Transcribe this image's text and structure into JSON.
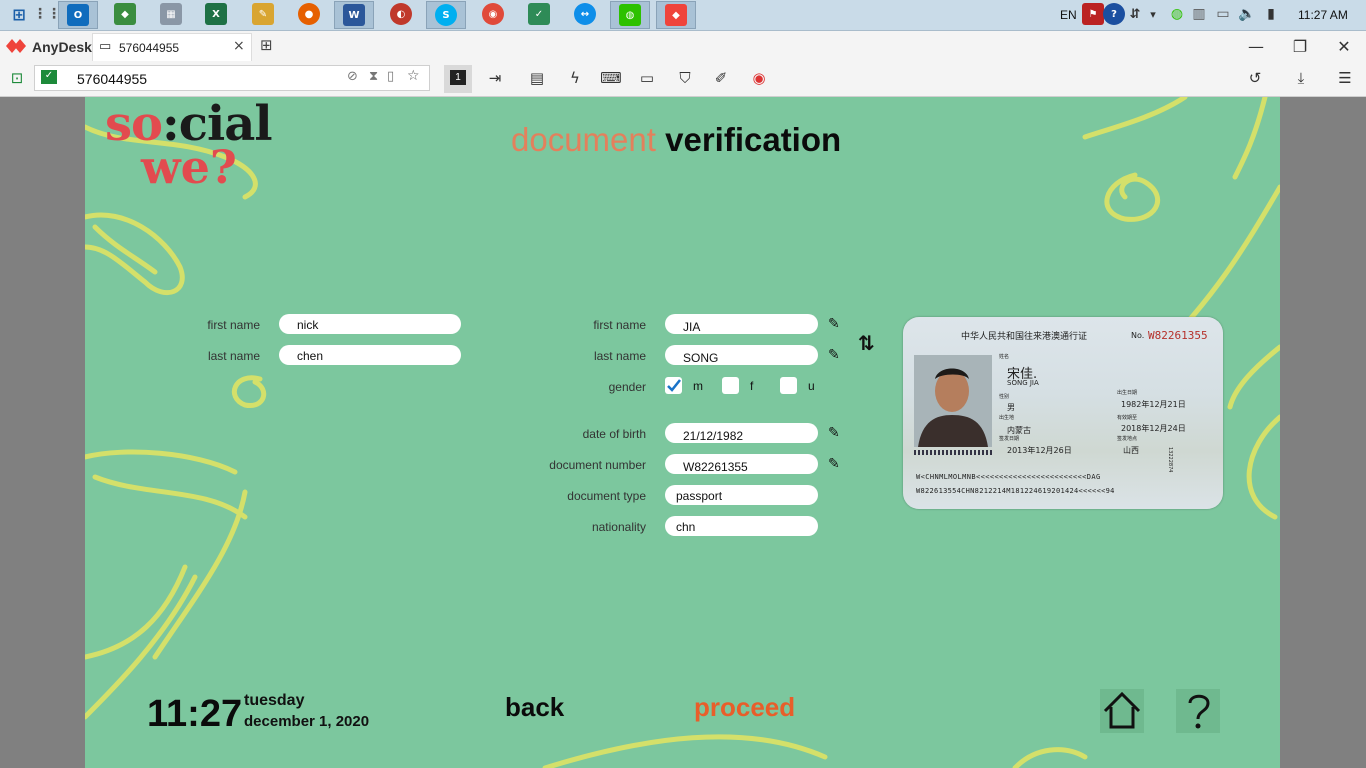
{
  "taskbar": {
    "clock": "11:27 AM",
    "language": "EN",
    "apps": [
      "outlook-icon",
      "app-icon",
      "calculator-icon",
      "excel-icon",
      "paint-icon",
      "firefox-icon",
      "word-icon",
      "anydesk-clone-icon",
      "skype-icon",
      "chrome-icon",
      "security-icon",
      "teamviewer-icon",
      "wechat-icon",
      "anydesk-icon"
    ]
  },
  "anydesk": {
    "app_name": "AnyDesk",
    "tab_label": "576044955",
    "address": "576044955",
    "display_number": "1"
  },
  "screen": {
    "logo_line1_a": "so",
    "logo_line1_b": ":cial",
    "logo_line2": "we?",
    "title_part1": "document",
    "title_part2": "verification",
    "left_form": {
      "first_name_label": "first name",
      "first_name_value": "nick",
      "last_name_label": "last name",
      "last_name_value": "chen"
    },
    "right_form": {
      "first_name_label": "first name",
      "first_name_value": "JIA",
      "last_name_label": "last name",
      "last_name_value": "SONG",
      "gender_label": "gender",
      "gender_options": [
        "m",
        "f",
        "u"
      ],
      "gender_selected": "m",
      "dob_label": "date of birth",
      "dob_value": "21/12/1982",
      "doc_number_label": "document number",
      "doc_number_value": "W82261355",
      "doc_type_label": "document type",
      "doc_type_value": "passport",
      "nationality_label": "nationality",
      "nationality_value": "chn"
    },
    "id_card": {
      "header": "中华人民共和国往来港澳通行证",
      "no_label": "No.",
      "no_value": "W82261355",
      "name_label": "姓名",
      "name_cn": "宋佳.",
      "name_en": "SONG JIA",
      "dob_label": "出生日期",
      "sex_label": "性别",
      "sex_value": "男",
      "dob_value": "1982年12月21日",
      "place_label": "出生地",
      "place_value": "内蒙古",
      "expiry_label": "有效期至",
      "expiry_value": "2018年12月24日",
      "issue_date_label": "签发日期",
      "issue_date_value": "2013年12月26日",
      "issue_place_label": "签发地点",
      "issue_place_value": "山西",
      "side_number": "13222874",
      "mrz1": "W<CHNMLMOLMNB<<<<<<<<<<<<<<<<<<<<<<<<DAG",
      "mrz2": "W822613554CHN8212214M181224619201424<<<<<<94"
    },
    "clock_time": "11:27",
    "clock_day": "tuesday",
    "clock_date": "december 1, 2020",
    "back_label": "back",
    "proceed_label": "proceed"
  },
  "colors": {
    "background": "#7cc79e",
    "accent_orange": "#e85e2a",
    "title_orange": "#e3805c",
    "logo_red": "#e24b4f",
    "deco_yellow": "#d4e06a"
  }
}
